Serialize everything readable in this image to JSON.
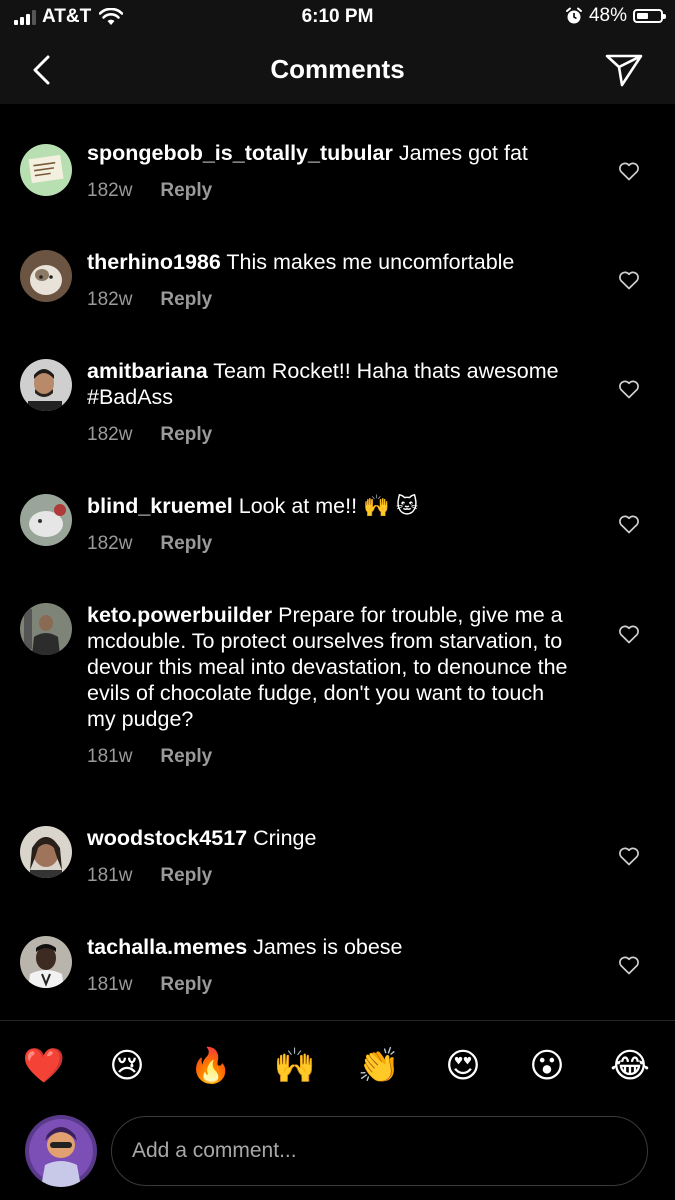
{
  "status_bar": {
    "carrier": "AT&T",
    "time": "6:10 PM",
    "battery_percent": "48%",
    "battery_level": 0.48,
    "signal_bars_filled": 3,
    "icons": [
      "signal-icon",
      "wifi-icon",
      "alarm-icon",
      "battery-icon"
    ]
  },
  "header": {
    "title": "Comments",
    "back_icon": "chevron-left-icon",
    "send_icon": "paper-plane-icon"
  },
  "comments": [
    {
      "username": "spongebob_is_totally_tubular",
      "text": "James got fat",
      "age": "182w",
      "reply_label": "Reply"
    },
    {
      "username": "therhino1986",
      "text": "This makes me uncomfortable",
      "age": "182w",
      "reply_label": "Reply"
    },
    {
      "username": "amitbariana",
      "text": "Team Rocket!! Haha thats awesome #BadAss",
      "age": "182w",
      "reply_label": "Reply"
    },
    {
      "username": "blind_kruemel",
      "text": "Look at me!! 🙌 🐱",
      "age": "182w",
      "reply_label": "Reply"
    },
    {
      "username": "keto.powerbuilder",
      "text": "Prepare for trouble, give me a mcdouble. To protect ourselves from starvation, to devour this meal into devastation, to denounce the evils of chocolate fudge, don't you want to touch my pudge?",
      "age": "181w",
      "reply_label": "Reply"
    },
    {
      "username": "woodstock4517",
      "text": "Cringe",
      "age": "181w",
      "reply_label": "Reply"
    },
    {
      "username": "tachalla.memes",
      "text": "James is obese",
      "age": "181w",
      "reply_label": "Reply"
    }
  ],
  "quick_reactions": [
    "❤️",
    "😢",
    "🔥",
    "🙌",
    "👏",
    "😍",
    "😮",
    "😂"
  ],
  "comment_input": {
    "placeholder": "Add a comment..."
  }
}
